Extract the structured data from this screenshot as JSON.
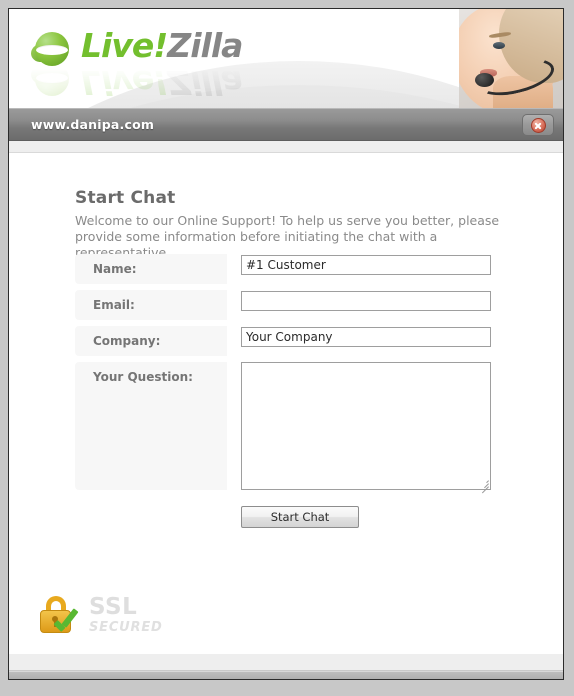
{
  "window": {
    "url_bar": {
      "url": "www.danipa.com",
      "close_icon": "close-icon"
    }
  },
  "branding": {
    "logo_first": "Live!",
    "logo_second": "Zilla",
    "logo_mark_icon": "livezilla-ball-icon",
    "agent_photo_icon": "support-agent-headset-photo",
    "colors": {
      "green": "#73bf2e",
      "gray": "#868686"
    }
  },
  "main": {
    "title": "Start Chat",
    "intro": "Welcome to our Online Support! To help us serve you better, please provide some information before initiating the chat with a representative.",
    "fields": [
      {
        "label": "Name:",
        "value": "#1 Customer",
        "placeholder": "",
        "type": "text"
      },
      {
        "label": "Email:",
        "value": "",
        "placeholder": "",
        "type": "text"
      },
      {
        "label": "Company:",
        "value": "Your Company",
        "placeholder": "",
        "type": "text"
      },
      {
        "label": "Your Question:",
        "value": "",
        "placeholder": "",
        "type": "textarea"
      }
    ],
    "submit_label": "Start Chat"
  },
  "ssl_badge": {
    "main": "SSL",
    "sub": "SECURED",
    "lock_icon": "padlock-icon",
    "check_icon": "green-check-icon"
  }
}
